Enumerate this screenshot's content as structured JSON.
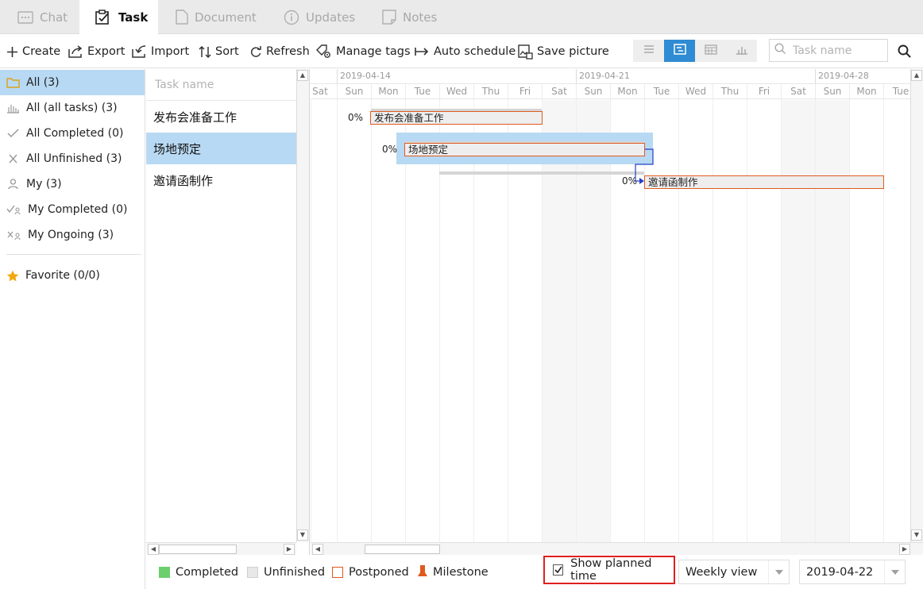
{
  "tabs": {
    "chat": "Chat",
    "task": "Task",
    "document": "Document",
    "updates": "Updates",
    "notes": "Notes"
  },
  "toolbar": {
    "create": "Create",
    "export": "Export",
    "import": "Import",
    "sort": "Sort",
    "refresh": "Refresh",
    "manage_tags": "Manage tags",
    "auto_schedule": "Auto schedule",
    "save_picture": "Save picture",
    "views": [
      "list-view-icon",
      "gantt-view-icon",
      "calendar-view-icon",
      "chart-view-icon"
    ],
    "active_view": "gantt-view-icon",
    "search_placeholder": "Task name"
  },
  "sidebar": {
    "items": [
      {
        "label": "All (3)",
        "icon": "folder-icon",
        "active": true
      },
      {
        "label": "All (all tasks) (3)",
        "icon": "all-tasks-icon"
      },
      {
        "label": "All Completed (0)",
        "icon": "check-icon"
      },
      {
        "label": "All Unfinished (3)",
        "icon": "cross-icon"
      },
      {
        "label": "My (3)",
        "icon": "person-icon"
      },
      {
        "label": "My Completed (0)",
        "icon": "my-completed-icon"
      },
      {
        "label": "My Ongoing (3)",
        "icon": "my-ongoing-icon"
      }
    ],
    "favorite": {
      "label": "Favorite (0/0)",
      "icon": "star-icon"
    }
  },
  "tasklist": {
    "header": "Task name",
    "rows": [
      "发布会准备工作",
      "场地预定",
      "邀请函制作"
    ],
    "selected_index": 1
  },
  "gantt": {
    "weeks": [
      "2019-04-14",
      "2019-04-21",
      "2019-04-28"
    ],
    "days": [
      "Sat",
      "Sun",
      "Mon",
      "Tue",
      "Wed",
      "Thu",
      "Fri",
      "Sat",
      "Sun",
      "Mon",
      "Tue",
      "Wed",
      "Thu",
      "Fri",
      "Sat",
      "Sun",
      "Mon",
      "Tue"
    ],
    "tasks": [
      {
        "name": "发布会准备工作",
        "progress": "0%"
      },
      {
        "name": "场地预定",
        "progress": "0%"
      },
      {
        "name": "邀请函制作",
        "progress": "0%"
      }
    ]
  },
  "footer": {
    "legend": [
      {
        "label": "Completed",
        "color": "#6ccf6c"
      },
      {
        "label": "Unfinished",
        "color": "#e8e8e8"
      },
      {
        "label": "Postponed",
        "color": "#e05a1f"
      },
      {
        "label": "Milestone",
        "color": "#e05a1f"
      }
    ],
    "show_planned_time": "Show planned time",
    "show_planned_checked": true,
    "view_select": "Weekly view",
    "date_select": "2019-04-22"
  },
  "colors": {
    "accent": "#2f8bd3",
    "selection": "#b8d9f3",
    "postponed_border": "#e05a1f",
    "highlight_box": "#e02020"
  }
}
